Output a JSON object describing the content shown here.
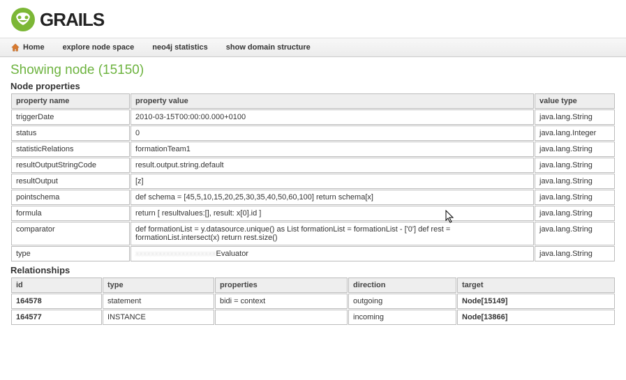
{
  "logo_text": "GRAILS",
  "nav": {
    "home": "Home",
    "explore": "explore node space",
    "stats": "neo4j statistics",
    "domain": "show domain structure"
  },
  "title": "Showing node (15150)",
  "sections": {
    "props": "Node properties",
    "rels": "Relationships"
  },
  "props_headers": {
    "name": "property name",
    "value": "property value",
    "type": "value type"
  },
  "props": [
    {
      "name": "triggerDate",
      "value": "2010-03-15T00:00:00.000+0100",
      "type": "java.lang.String"
    },
    {
      "name": "status",
      "value": "0",
      "type": "java.lang.Integer"
    },
    {
      "name": "statisticRelations",
      "value": "formationTeam1",
      "type": "java.lang.String"
    },
    {
      "name": "resultOutputStringCode",
      "value": "result.output.string.default",
      "type": "java.lang.String"
    },
    {
      "name": "resultOutput",
      "value": "[z]",
      "type": "java.lang.String"
    },
    {
      "name": "pointschema",
      "value": "def schema = [45,5,10,15,20,25,30,35,40,50,60,100] return schema[x]",
      "type": "java.lang.String"
    },
    {
      "name": "formula",
      "value": "return [ resultvalues:[], result: x[0].id ]",
      "type": "java.lang.String"
    },
    {
      "name": "comparator",
      "value": "def formationList = y.datasource.unique() as List formationList = formationList - ['0'] def rest = formationList.intersect(x) return rest.size()",
      "type": "java.lang.String"
    },
    {
      "name": "type",
      "value": "Evaluator",
      "type": "java.lang.String",
      "blur_prefix": "xxxxxxxxxxxxxxxxxxxxx"
    }
  ],
  "rels_headers": {
    "id": "id",
    "type": "type",
    "props": "properties",
    "dir": "direction",
    "target": "target"
  },
  "rels": [
    {
      "id": "164578",
      "type": "statement",
      "props": "bidi = context",
      "dir": "outgoing",
      "target": "Node[15149]"
    },
    {
      "id": "164577",
      "type": "INSTANCE",
      "props": "",
      "dir": "incoming",
      "target": "Node[13866]"
    }
  ]
}
